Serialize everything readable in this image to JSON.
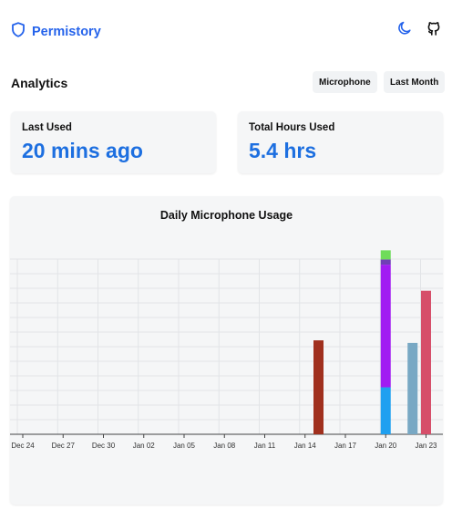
{
  "app": {
    "name": "Permistory"
  },
  "icons": {
    "brand": "shield-icon",
    "theme": "moon-icon",
    "repo": "github-icon"
  },
  "colors": {
    "accent": "#2563eb",
    "stat_value": "#1d6fe0"
  },
  "analytics": {
    "title": "Analytics",
    "filters": {
      "source": "Microphone",
      "range": "Last Month"
    }
  },
  "stats": {
    "last_used": {
      "label": "Last Used",
      "value": "20 mins ago"
    },
    "total_hours": {
      "label": "Total Hours Used",
      "value": "5.4 hrs"
    }
  },
  "chart_data": {
    "type": "bar",
    "title": "Daily Microphone Usage",
    "xlabel": "",
    "ylabel": "",
    "x_ticks": [
      "Dec 24",
      "Dec 27",
      "Dec 30",
      "Jan 02",
      "Jan 05",
      "Jan 08",
      "Jan 11",
      "Jan 14",
      "Jan 17",
      "Jan 20",
      "Jan 23"
    ],
    "grid": true,
    "legend": "none",
    "ylim": [
      0,
      1.4
    ],
    "bars": [
      {
        "date": "Jan 15",
        "segments": [
          {
            "value": 0.72,
            "color": "#a0301e"
          }
        ]
      },
      {
        "date": "Jan 20",
        "segments": [
          {
            "value": 0.36,
            "color": "#1fa0f0"
          },
          {
            "value": 0.94,
            "color": "#a11cf2"
          },
          {
            "value": 0.04,
            "color": "#6f3fb5"
          },
          {
            "value": 0.07,
            "color": "#6fdc5a"
          }
        ]
      },
      {
        "date": "Jan 22",
        "segments": [
          {
            "value": 0.7,
            "color": "#78a8c4"
          }
        ]
      },
      {
        "date": "Jan 23",
        "segments": [
          {
            "value": 1.1,
            "color": "#d64f6a"
          }
        ]
      }
    ]
  }
}
